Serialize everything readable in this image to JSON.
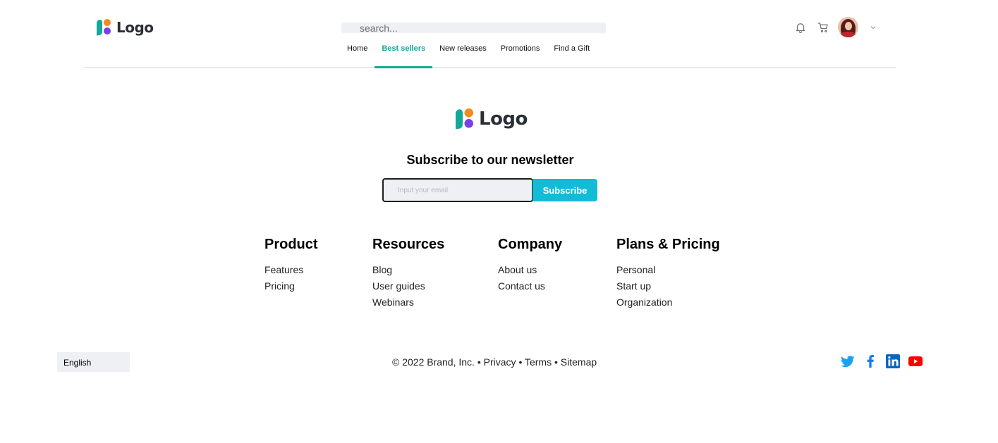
{
  "header": {
    "logo_text": "Logo",
    "search": {
      "placeholder": "search..."
    },
    "nav": [
      {
        "label": "Home",
        "active": false
      },
      {
        "label": "Best sellers",
        "active": true
      },
      {
        "label": "New releases",
        "active": false
      },
      {
        "label": "Promotions",
        "active": false
      },
      {
        "label": "Find a Gift",
        "active": false
      }
    ],
    "icons": [
      "bell-icon",
      "cart-icon",
      "avatar",
      "chevron-down-icon"
    ]
  },
  "footer": {
    "logo_text": "Logo",
    "newsletter": {
      "title": "Subscribe to our newsletter",
      "email_placeholder": "Input your email",
      "button_label": "Subscribe"
    },
    "columns": [
      {
        "title": "Product",
        "links": [
          "Features",
          "Pricing"
        ]
      },
      {
        "title": "Resources",
        "links": [
          "Blog",
          "User guides",
          "Webinars"
        ]
      },
      {
        "title": "Company",
        "links": [
          "About us",
          "Contact us"
        ]
      },
      {
        "title": "Plans & Pricing",
        "links": [
          "Personal",
          "Start up",
          "Organization"
        ]
      }
    ],
    "language": "English",
    "copyright": {
      "text": "© 2022 Brand, Inc.",
      "sep": "•",
      "privacy": "Privacy",
      "terms": "Terms",
      "sitemap": "Sitemap"
    },
    "social": [
      "twitter-icon",
      "facebook-icon",
      "linkedin-icon",
      "youtube-icon"
    ]
  },
  "colors": {
    "accent": "#14a89a",
    "button": "#12bcd6",
    "input_bg": "#eef0f3"
  }
}
